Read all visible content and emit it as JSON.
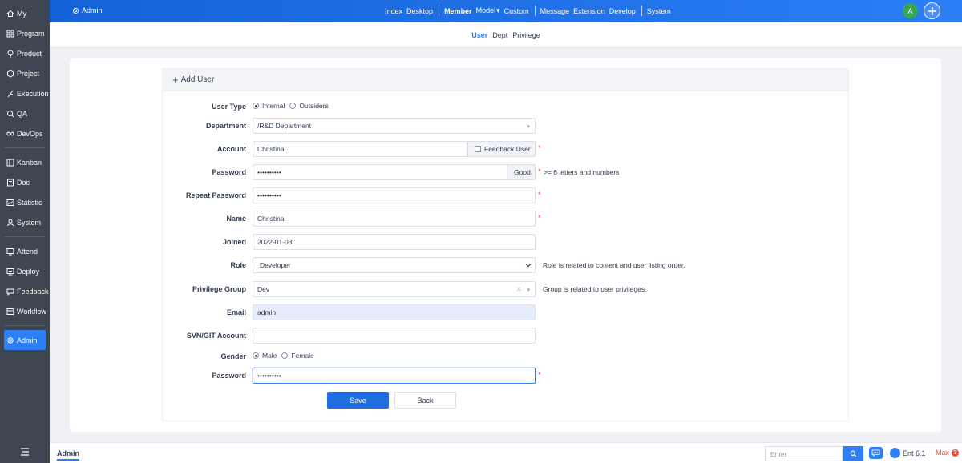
{
  "sidebar": {
    "items": [
      {
        "label": "My",
        "icon": "home-icon"
      },
      {
        "label": "Program",
        "icon": "grid-icon"
      },
      {
        "label": "Product",
        "icon": "lightbulb-icon"
      },
      {
        "label": "Project",
        "icon": "project-icon"
      },
      {
        "label": "Execution",
        "icon": "run-icon"
      },
      {
        "label": "QA",
        "icon": "magnifier-icon"
      },
      {
        "label": "DevOps",
        "icon": "infinity-icon"
      },
      {
        "label": "Kanban",
        "icon": "kanban-icon"
      },
      {
        "label": "Doc",
        "icon": "doc-icon"
      },
      {
        "label": "Statistic",
        "icon": "chart-icon"
      },
      {
        "label": "System",
        "icon": "users-icon"
      },
      {
        "label": "Attend",
        "icon": "attend-icon"
      },
      {
        "label": "Deploy",
        "icon": "deploy-icon"
      },
      {
        "label": "Feedback",
        "icon": "feedback-icon"
      },
      {
        "label": "Workflow",
        "icon": "workflow-icon"
      },
      {
        "label": "Admin",
        "icon": "gear-icon"
      }
    ]
  },
  "topbar": {
    "app_name": "Admin",
    "nav": [
      "Index",
      "Desktop",
      "Member",
      "Model",
      "Custom",
      "Message",
      "Extension",
      "Develop",
      "System"
    ],
    "model_caret": "▾",
    "avatar_letter": "A"
  },
  "subnav": {
    "tabs": [
      "User",
      "Dept",
      "Privilege"
    ]
  },
  "form": {
    "title": "Add User",
    "user_type": {
      "label": "User Type",
      "options": [
        "Internal",
        "Outsiders"
      ]
    },
    "department": {
      "label": "Department",
      "value": "/R&D Department"
    },
    "account": {
      "label": "Account",
      "value": "Christina",
      "addon": "Feedback User"
    },
    "password": {
      "label": "Password",
      "value": "••••••••••",
      "strength": "Good",
      "hint": ">= 6 letters and numbers"
    },
    "repeat_password": {
      "label": "Repeat Password",
      "value": "••••••••••"
    },
    "name": {
      "label": "Name",
      "value": "Christina"
    },
    "joined": {
      "label": "Joined",
      "value": "2022-01-03"
    },
    "role": {
      "label": "Role",
      "value": "Developer",
      "hint": "Role is related to content and user listing order."
    },
    "privilege_group": {
      "label": "Privilege Group",
      "value": "Dev",
      "hint": "Group is related to user privileges."
    },
    "email": {
      "label": "Email",
      "value": "admin"
    },
    "svn": {
      "label": "SVN/GIT Account",
      "value": ""
    },
    "gender": {
      "label": "Gender",
      "options": [
        "Male",
        "Female"
      ]
    },
    "verify_password": {
      "label": "Password",
      "value": "••••••••••"
    },
    "required_mark": "*",
    "save_label": "Save",
    "back_label": "Back"
  },
  "footer": {
    "tab": "Admin",
    "search_placeholder": "Enter",
    "version": "Ent 6.1",
    "max_label": "Max"
  },
  "colors": {
    "accent": "#2e7ff5",
    "sidebar": "#3d4651",
    "required": "#e74c3c"
  }
}
